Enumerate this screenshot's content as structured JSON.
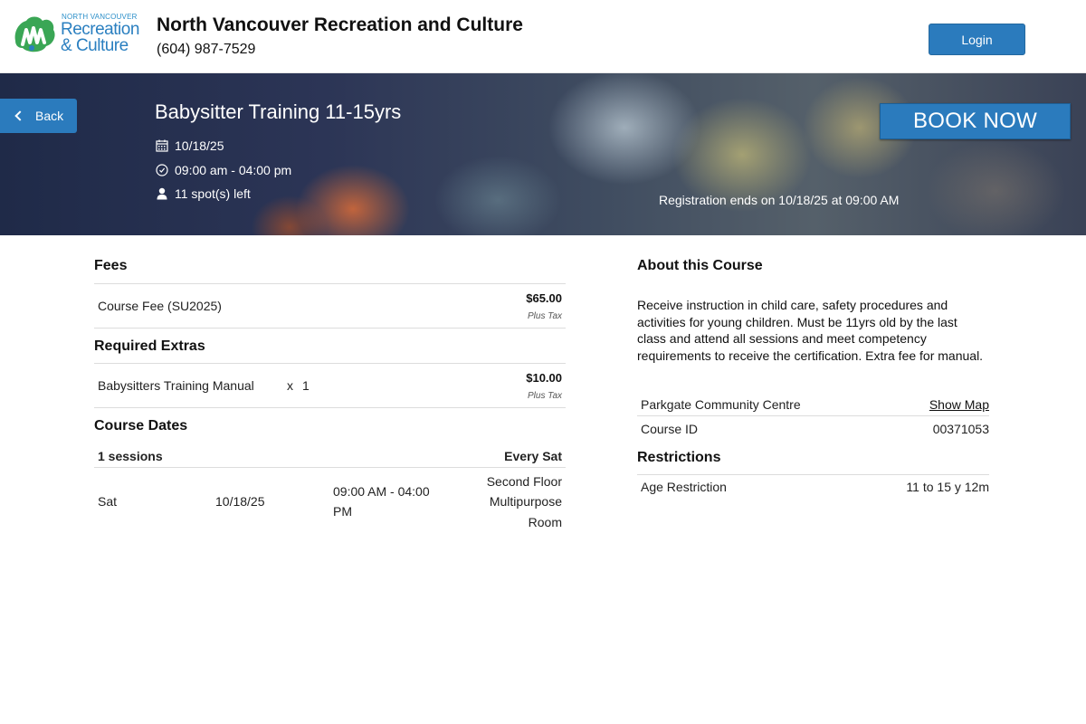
{
  "header": {
    "logo": {
      "small_text": "NORTH VANCOUVER",
      "line1": "Recreation",
      "line2": "& Culture",
      "brand_green": "#3aa655",
      "brand_blue": "#2a7fc0"
    },
    "org_name": "North Vancouver Recreation and Culture",
    "phone": "(604) 987-7529",
    "login_label": "Login"
  },
  "hero": {
    "back_label": "Back",
    "title": "Babysitter Training 11-15yrs",
    "date": "10/18/25",
    "time": "09:00 am - 04:00 pm",
    "spots": "11 spot(s) left",
    "book_label": "BOOK NOW",
    "registration_ends": "Registration ends on 10/18/25 at 09:00 AM",
    "icons": {
      "date": "calendar-icon",
      "time": "clock-icon",
      "spots": "person-icon",
      "back": "chevron-left-icon"
    }
  },
  "fees": {
    "title": "Fees",
    "items": [
      {
        "name": "Course Fee (SU2025)",
        "price": "$65.00",
        "tax": "Plus Tax"
      }
    ]
  },
  "extras": {
    "title": "Required Extras",
    "items": [
      {
        "name": "Babysitters Training Manual",
        "qty_prefix": "x",
        "qty": "1",
        "price": "$10.00",
        "tax": "Plus Tax"
      }
    ]
  },
  "dates": {
    "title": "Course Dates",
    "sessions": "1 sessions",
    "frequency": "Every Sat",
    "rows": [
      {
        "day": "Sat",
        "date": "10/18/25",
        "time_line1": "09:00 AM - 04:00",
        "time_line2": "PM",
        "loc_line1": "Second Floor",
        "loc_line2": "Multipurpose",
        "loc_line3": "Room"
      }
    ]
  },
  "about": {
    "title": "About this Course",
    "description": "Receive instruction in child care, safety procedures and activities for young children. Must be 11yrs old by the last class and attend all sessions and meet competency requirements to receive the certification. Extra fee for manual.",
    "location": "Parkgate Community Centre",
    "show_map": "Show Map",
    "course_id_label": "Course ID",
    "course_id": "00371053"
  },
  "restrictions": {
    "title": "Restrictions",
    "age_label": "Age Restriction",
    "age_value": "11 to 15 y 12m"
  },
  "colors": {
    "primary_button": "#2b7bbd"
  }
}
